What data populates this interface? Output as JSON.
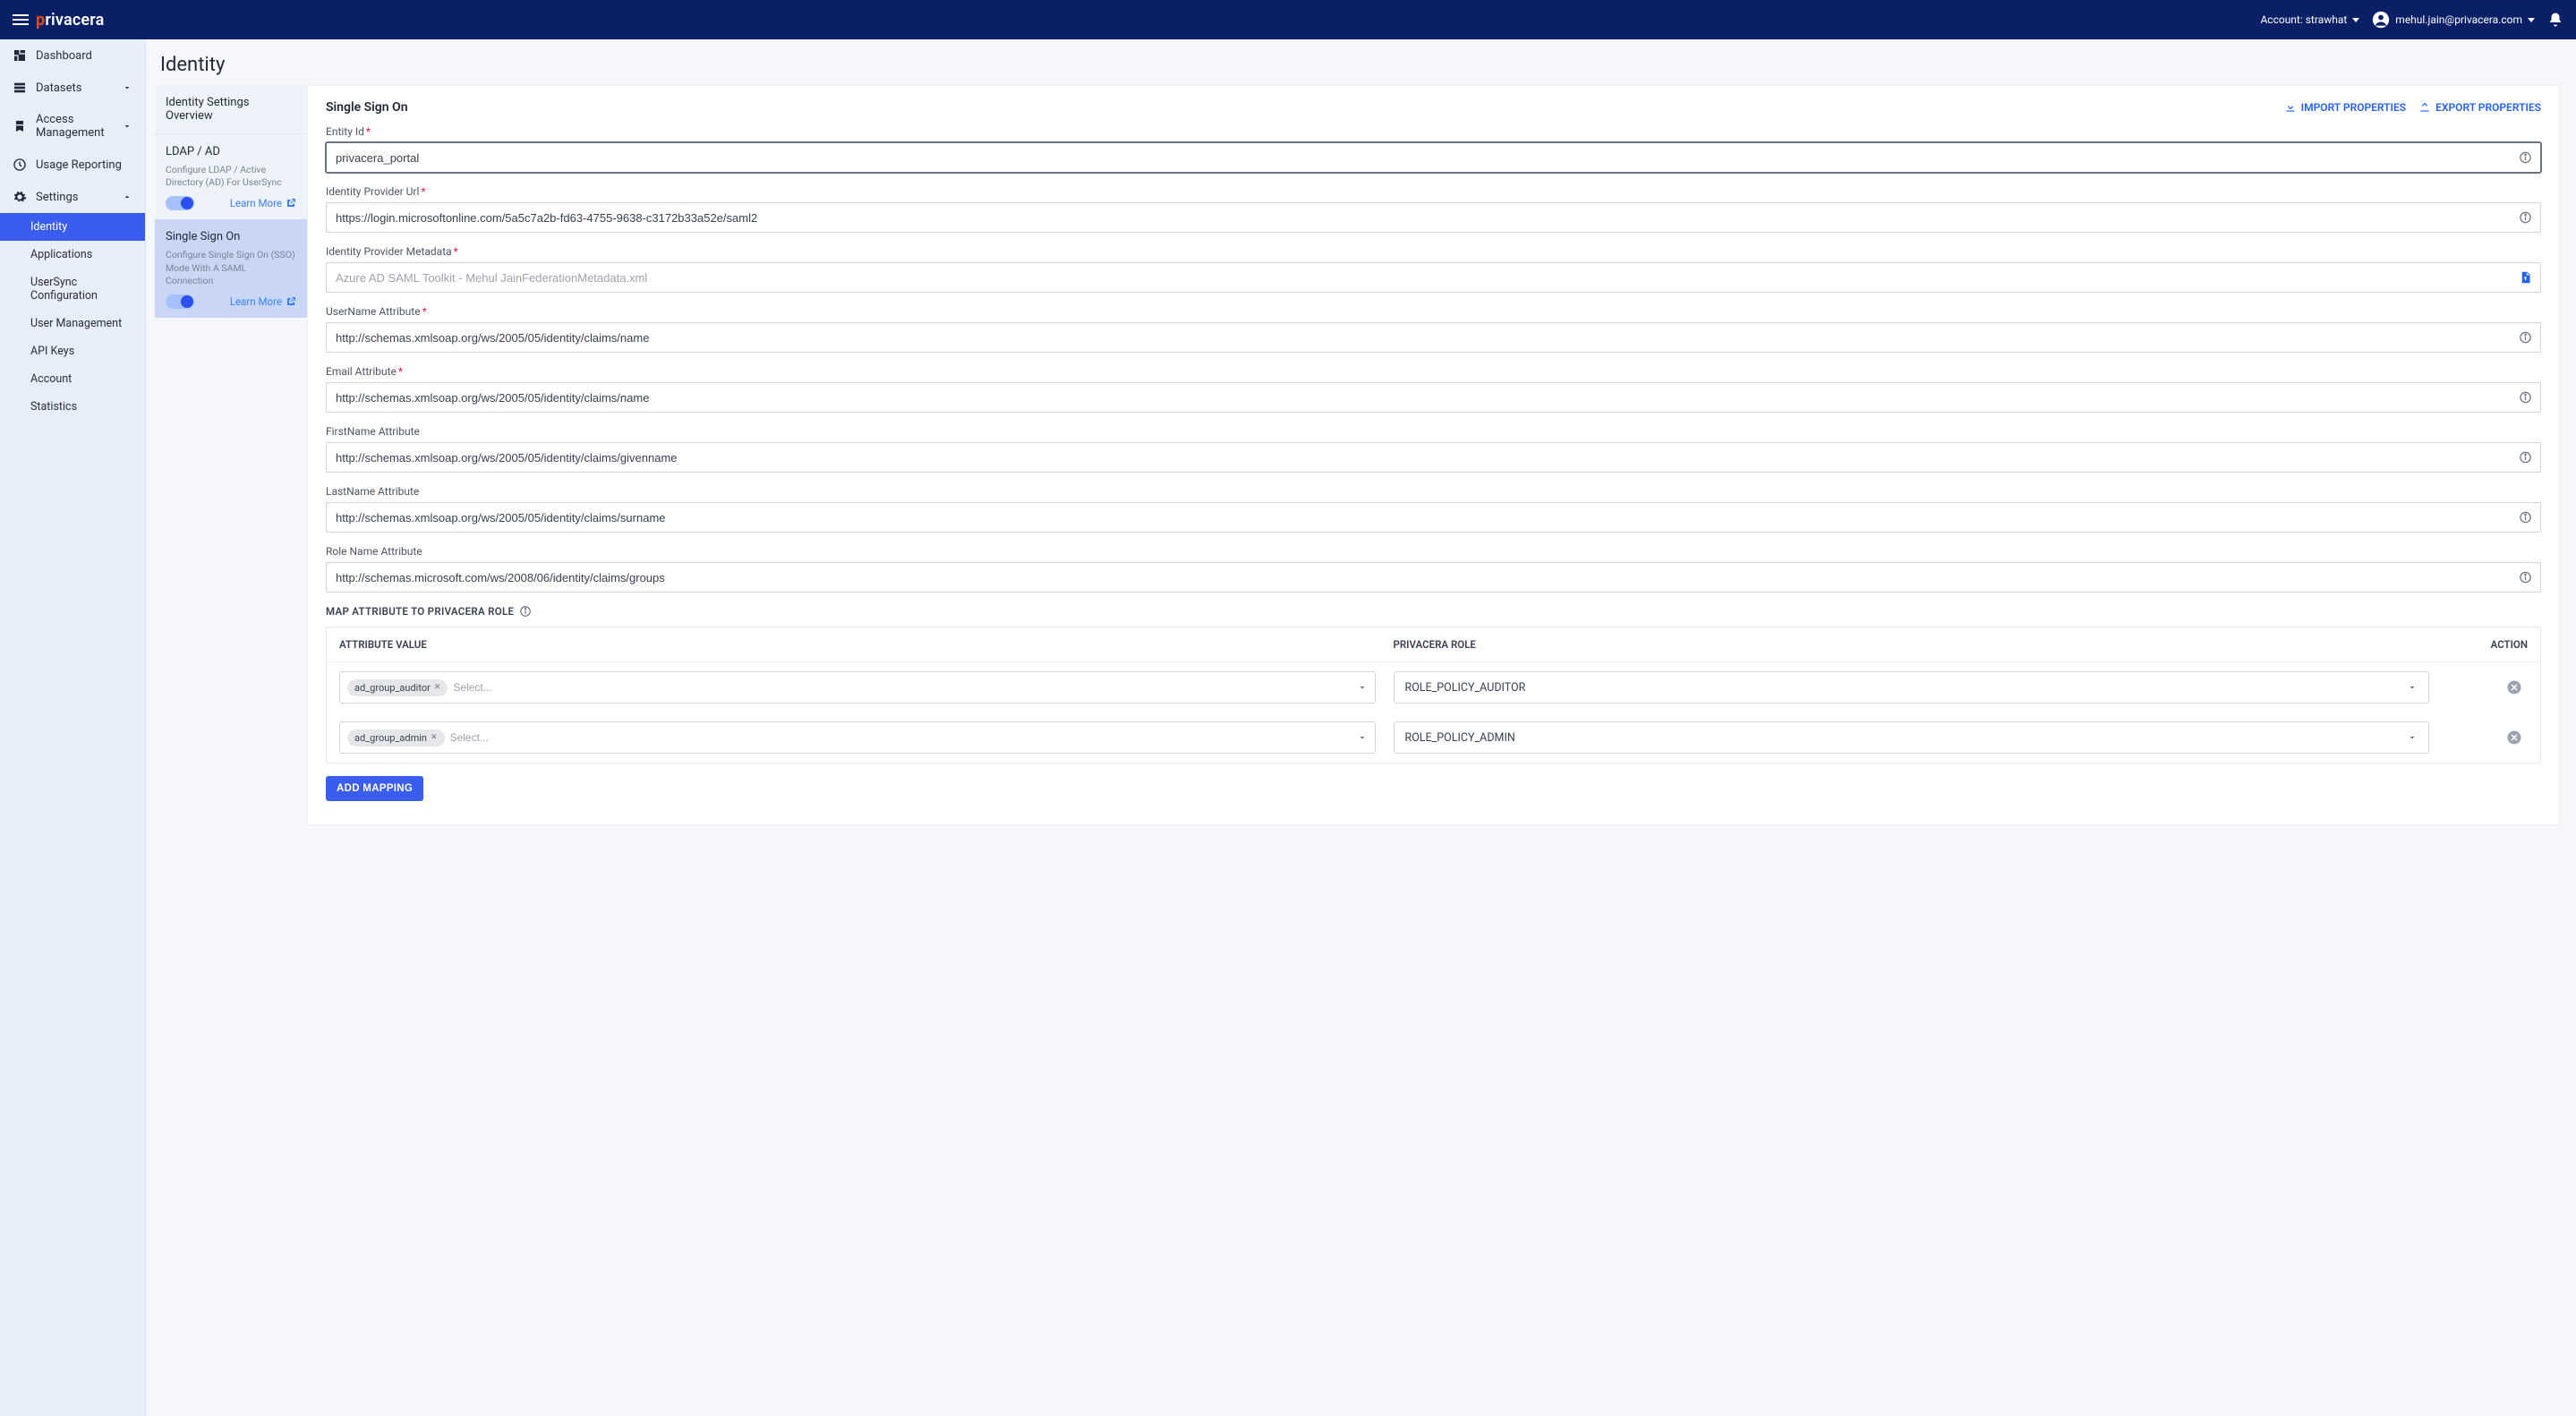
{
  "header": {
    "brand_prefix": "p",
    "brand_rest": "rivacera",
    "account_label": "Account: strawhat",
    "user_email": "mehul.jain@privacera.com"
  },
  "sidenav": {
    "dashboard": "Dashboard",
    "datasets": "Datasets",
    "access_management": "Access Management",
    "usage_reporting": "Usage Reporting",
    "settings": "Settings",
    "sub": {
      "identity": "Identity",
      "applications": "Applications",
      "usersync": "UserSync Configuration",
      "user_mgmt": "User Management",
      "api_keys": "API Keys",
      "account": "Account",
      "statistics": "Statistics"
    }
  },
  "page": {
    "title": "Identity"
  },
  "overview": {
    "header": "Identity Settings Overview",
    "ldap": {
      "title": "LDAP / AD",
      "desc": "Configure LDAP / Active Directory (AD) For UserSync",
      "learn_more": "Learn More"
    },
    "sso": {
      "title": "Single Sign On",
      "desc": "Configure Single Sign On (SSO) Mode With A SAML Connection",
      "learn_more": "Learn More"
    }
  },
  "form": {
    "title": "Single Sign On",
    "import_label": "IMPORT PROPERTIES",
    "export_label": "EXPORT PROPERTIES",
    "fields": {
      "entity_id": {
        "label": "Entity Id",
        "value": "privacera_portal"
      },
      "idp_url": {
        "label": "Identity Provider Url",
        "value": "https://login.microsoftonline.com/5a5c7a2b-fd63-4755-9638-c3172b33a52e/saml2"
      },
      "idp_meta": {
        "label": "Identity Provider Metadata",
        "value": "Azure AD SAML Toolkit - Mehul JainFederationMetadata.xml"
      },
      "username_attr": {
        "label": "UserName Attribute",
        "value": "http://schemas.xmlsoap.org/ws/2005/05/identity/claims/name"
      },
      "email_attr": {
        "label": "Email Attribute",
        "value": "http://schemas.xmlsoap.org/ws/2005/05/identity/claims/name"
      },
      "first_attr": {
        "label": "FirstName Attribute",
        "value": "http://schemas.xmlsoap.org/ws/2005/05/identity/claims/givenname"
      },
      "last_attr": {
        "label": "LastName Attribute",
        "value": "http://schemas.xmlsoap.org/ws/2005/05/identity/claims/surname"
      },
      "role_attr": {
        "label": "Role Name Attribute",
        "value": "http://schemas.microsoft.com/ws/2008/06/identity/claims/groups"
      }
    },
    "map_section_title": "MAP ATTRIBUTE TO PRIVACERA ROLE",
    "table": {
      "col_attr": "ATTRIBUTE VALUE",
      "col_role": "PRIVACERA ROLE",
      "col_action": "ACTION",
      "select_placeholder": "Select...",
      "rows": [
        {
          "chip": "ad_group_auditor",
          "role": "ROLE_POLICY_AUDITOR"
        },
        {
          "chip": "ad_group_admin",
          "role": "ROLE_POLICY_ADMIN"
        }
      ]
    },
    "add_mapping": "ADD MAPPING"
  }
}
